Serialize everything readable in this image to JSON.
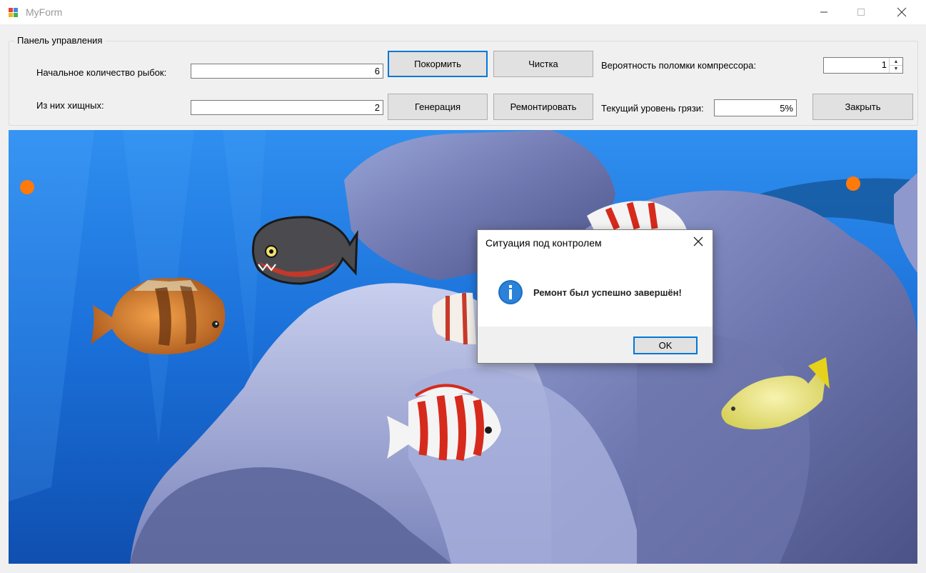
{
  "window": {
    "title": "MyForm"
  },
  "panel": {
    "legend": "Панель управления",
    "initial_count_label": "Начальное количество рыбок:",
    "initial_count_value": "6",
    "predators_label": "Из них хищных:",
    "predators_value": "2",
    "feed_button": "Покормить",
    "clean_button": "Чистка",
    "generate_button": "Генерация",
    "repair_button": "Ремонтировать",
    "compressor_label": "Вероятность поломки компрессора:",
    "compressor_value": "1",
    "dirt_label": "Текущий уровень грязи:",
    "dirt_value": "5%",
    "close_button": "Закрыть"
  },
  "dialog": {
    "title": "Ситуация под контролем",
    "message": "Ремонт был успешно завершён!",
    "ok_button": "OK",
    "icon": "info-icon"
  },
  "colors": {
    "accent": "#0078d7",
    "food": "#ff7a0a",
    "water": "#1a6fd8"
  }
}
